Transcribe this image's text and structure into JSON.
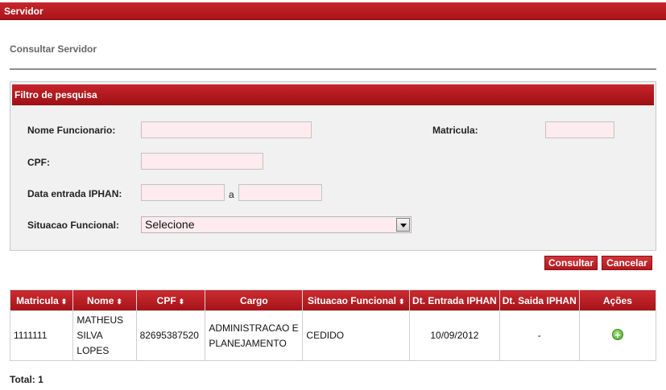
{
  "header": {
    "title": "Servidor"
  },
  "page": {
    "subtitle": "Consultar Servidor"
  },
  "filter": {
    "title": "Filtro de pesquisa",
    "nome_label": "Nome Funcionario:",
    "nome_value": "",
    "matricula_label": "Matricula:",
    "matricula_value": "",
    "cpf_label": "CPF:",
    "cpf_value": "",
    "data_label": "Data entrada IPHAN:",
    "data_from": "",
    "data_sep": "a",
    "data_to": "",
    "situacao_label": "Situacao Funcional:",
    "situacao_selected": "Selecione"
  },
  "buttons": {
    "consultar": "Consultar",
    "cancelar": "Cancelar"
  },
  "table": {
    "headers": {
      "matricula": "Matricula",
      "nome": "Nome",
      "cpf": "CPF",
      "cargo": "Cargo",
      "situacao": "Situacao Funcional",
      "dt_entrada": "Dt. Entrada IPHAN",
      "dt_saida": "Dt. Saida IPHAN",
      "acoes": "Ações"
    },
    "sort_glyph": "⬍",
    "rows": [
      {
        "matricula": "1111111",
        "nome": "MATHEUS SILVA LOPES",
        "cpf": "82695387520",
        "cargo": "ADMINISTRACAO E PLANEJAMENTO",
        "situacao": "CEDIDO",
        "dt_entrada": "10/09/2012",
        "dt_saida": "-",
        "acao_icon": "add-circle-icon",
        "acao_glyph": "+"
      }
    ]
  },
  "footer": {
    "total_label": "Total:",
    "total_value": "1"
  }
}
